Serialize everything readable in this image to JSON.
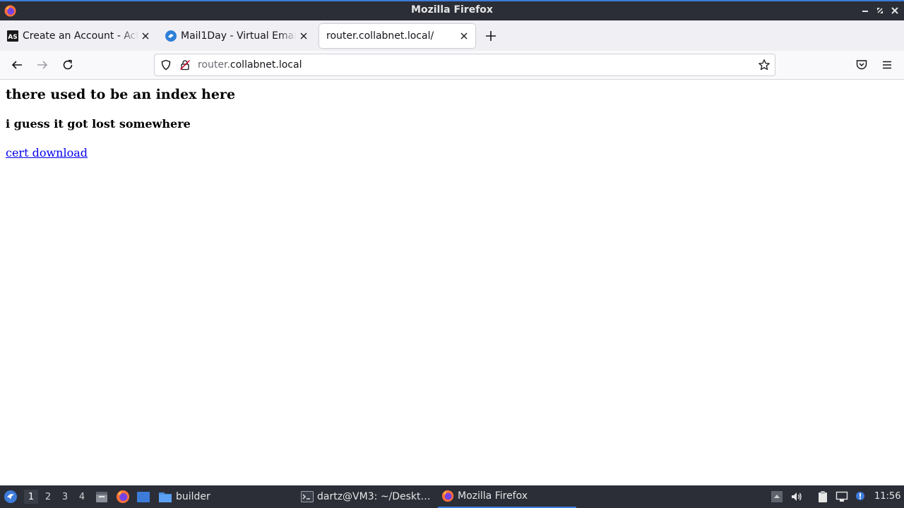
{
  "window": {
    "title": "Mozilla Firefox"
  },
  "tabs": [
    {
      "label": "Create an Account - ActiveState",
      "favicon": "activestate-icon",
      "active": false
    },
    {
      "label": "Mail1Day - Virtual Email client",
      "favicon": "mail1day-icon",
      "active": false
    },
    {
      "label": "router.collabnet.local/",
      "favicon": "none",
      "active": true
    }
  ],
  "navbar": {
    "url_subdomain": "router.",
    "url_domain": "collabnet.local"
  },
  "page": {
    "heading": "there used to be an index here",
    "subheading": "i guess it got lost somewhere",
    "link": "cert download"
  },
  "taskbar": {
    "workspaces": [
      "1",
      "2",
      "3",
      "4"
    ],
    "current_workspace": "1",
    "tasks": [
      {
        "label": "builder",
        "icon": "folder-icon"
      },
      {
        "label": "dartz@VM3: ~/Deskt…",
        "icon": "terminal-icon"
      },
      {
        "label": "Mozilla Firefox",
        "icon": "firefox-icon"
      }
    ],
    "clock": "11:56"
  },
  "colors": {
    "titlebar": "#2b2e37",
    "accent": "#3d7bd9",
    "link": "#0000ee"
  }
}
